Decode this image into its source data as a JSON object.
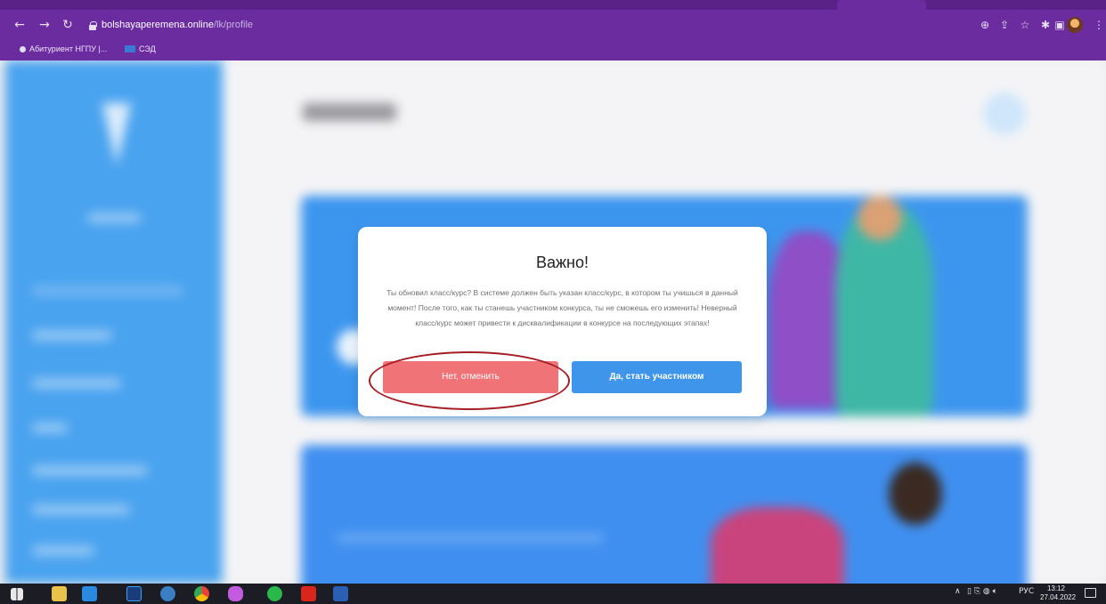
{
  "browser": {
    "url_host": "bolshayaperemena.online",
    "url_path": "/lk/profile",
    "bookmarks": [
      "Абитуриент НГПУ |...",
      "СЭД"
    ]
  },
  "dialog": {
    "title": "Важно!",
    "message": "Ты обновил класс/курс? В системе должен быть указан класс/курс, в котором ты учишься в данный момент! После того, как ты станешь участником конкурса, ты не сможешь его изменить! Неверный класс/курс может привести к дисквалификации в конкурсе на последующих этапах!",
    "cancel_label": "Нет, отменить",
    "confirm_label": "Да, стать участником"
  },
  "taskbar": {
    "lang": "РУС",
    "time": "13:12",
    "date": "27.04.2022"
  },
  "colors": {
    "browser_frame": "#6a2c9e",
    "sidebar": "#4aa3ef",
    "cancel_button": "#f07378",
    "confirm_button": "#3e95ea",
    "annotation_ellipse": "#a51e26"
  }
}
